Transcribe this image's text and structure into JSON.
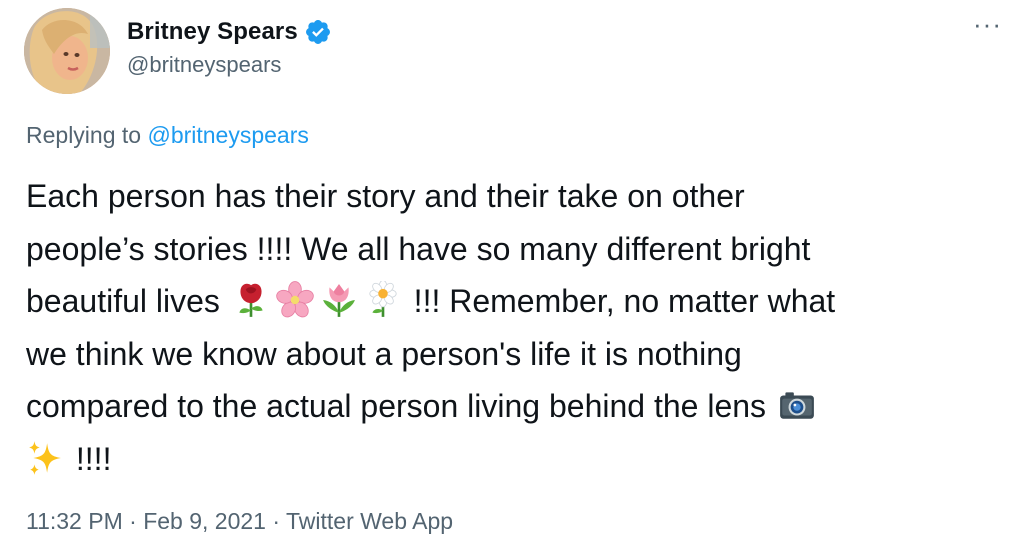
{
  "author": {
    "display_name": "Britney Spears",
    "handle": "@britneyspears",
    "verified": true,
    "verified_color": "#1d9bf0"
  },
  "reply": {
    "prefix": "Replying to ",
    "mention": "@britneyspears"
  },
  "tweet": {
    "line1": "Each person has their story and their take on other",
    "line2": "people’s stories !!!! We all have so many different bright",
    "line3a": "beautiful lives ",
    "line3b": " !!! Remember, no matter what",
    "line4": "we think we know about a person's life it is nothing",
    "line5": "compared to the actual person living behind the lens ",
    "line6": " !!!!",
    "emojis": [
      "rose-emoji",
      "cherry-blossom-emoji",
      "tulip-emoji",
      "daisy-emoji",
      "camera-emoji",
      "sparkles-emoji"
    ]
  },
  "meta": {
    "time": "11:32 PM",
    "date": "Feb 9, 2021",
    "source": "Twitter Web App",
    "separator": " · "
  },
  "menu": {
    "more_label": "···"
  },
  "colors": {
    "text": "#0f1419",
    "secondary": "#536471",
    "link": "#1d9bf0"
  }
}
